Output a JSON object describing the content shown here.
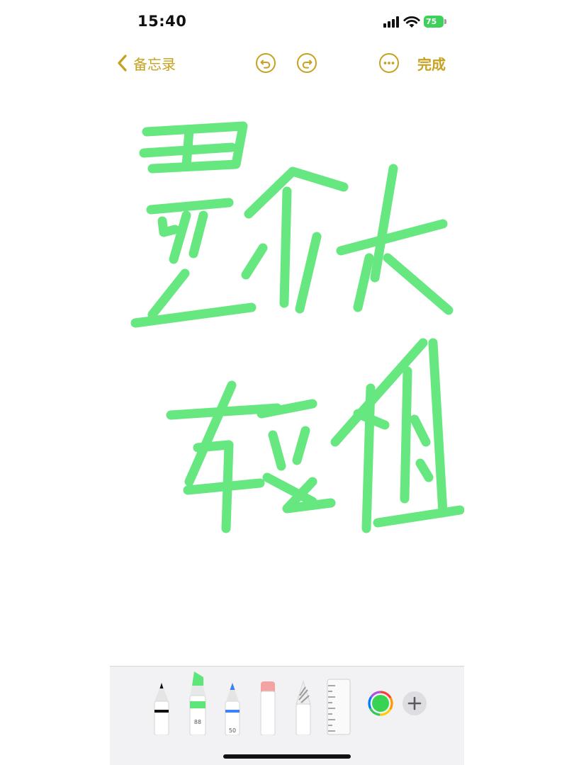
{
  "status_bar": {
    "time": "15:40",
    "battery_level": "75"
  },
  "nav": {
    "back_label": "备忘录",
    "done_label": "完成",
    "icons": [
      "chevron-left-icon",
      "undo-icon",
      "redo-icon",
      "more-icon"
    ]
  },
  "drawing": {
    "description_lines": [
      "墨水体",
      "较粗"
    ],
    "ink_color": "#5ee67a"
  },
  "toolbar": {
    "tools": [
      {
        "name": "pen",
        "icon": "pen-icon"
      },
      {
        "name": "marker",
        "icon": "marker-icon",
        "label": "88",
        "color": "#5ee67a"
      },
      {
        "name": "pencil",
        "icon": "pencil-icon",
        "label": "50",
        "color": "#3b82f6"
      },
      {
        "name": "eraser",
        "icon": "eraser-icon",
        "color": "#f4a3a3"
      },
      {
        "name": "lasso",
        "icon": "lasso-icon"
      },
      {
        "name": "ruler",
        "icon": "ruler-icon"
      }
    ],
    "selected_color": "#39d353",
    "add_icon": "plus-icon"
  },
  "colors": {
    "accent": "#c6a220",
    "battery": "#3fcf5b",
    "toolbar_bg": "#f2f2f4"
  }
}
